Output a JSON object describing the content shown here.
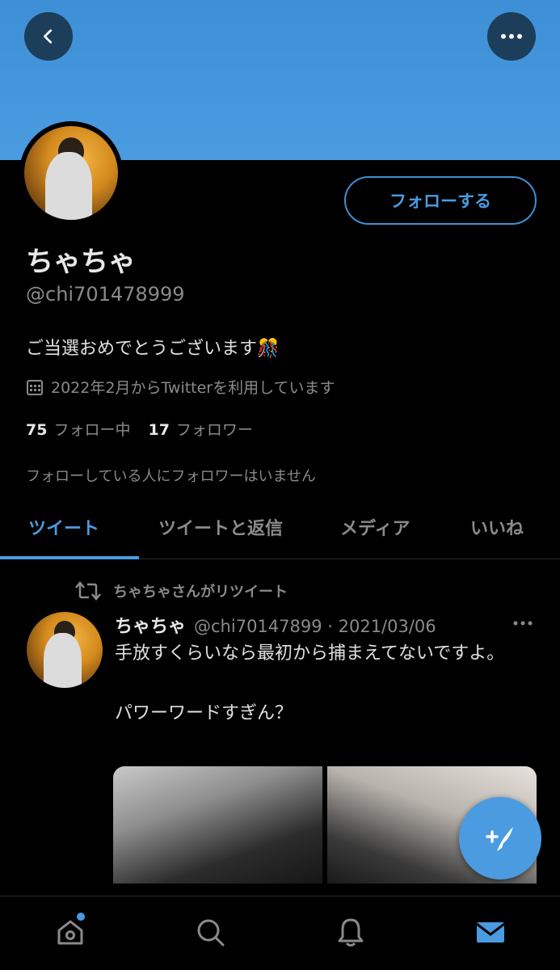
{
  "header": {
    "back_icon": "chevron-left-icon",
    "more_icon": "more-horizontal-icon",
    "banner_color": "#4a9be0"
  },
  "profile": {
    "follow_label": "フォローする",
    "name": "ちゃちゃ",
    "handle": "@chi701478999",
    "bio": "ご当選おめでとうございます🎊",
    "joined": "2022年2月からTwitterを利用しています",
    "following_count": "75",
    "following_label": "フォロー中",
    "followers_count": "17",
    "followers_label": "フォロワー",
    "mutual_note": "フォローしている人にフォロワーはいません"
  },
  "tabs": [
    {
      "label": "ツイート",
      "active": true
    },
    {
      "label": "ツイートと返信",
      "active": false
    },
    {
      "label": "メディア",
      "active": false
    },
    {
      "label": "いいね",
      "active": false
    }
  ],
  "tweet": {
    "retweet_note": "ちゃちゃさんがリツイート",
    "author_name": "ちゃちゃ",
    "author_meta": "@chi70147899 · 2021/03/06",
    "text": "手放すくらいなら最初から捕まえてないですよ。\n\nパワーワードすぎん？"
  },
  "accent_color": "#4a9be0",
  "nav": [
    "home-icon",
    "search-icon",
    "bell-icon",
    "mail-icon"
  ]
}
